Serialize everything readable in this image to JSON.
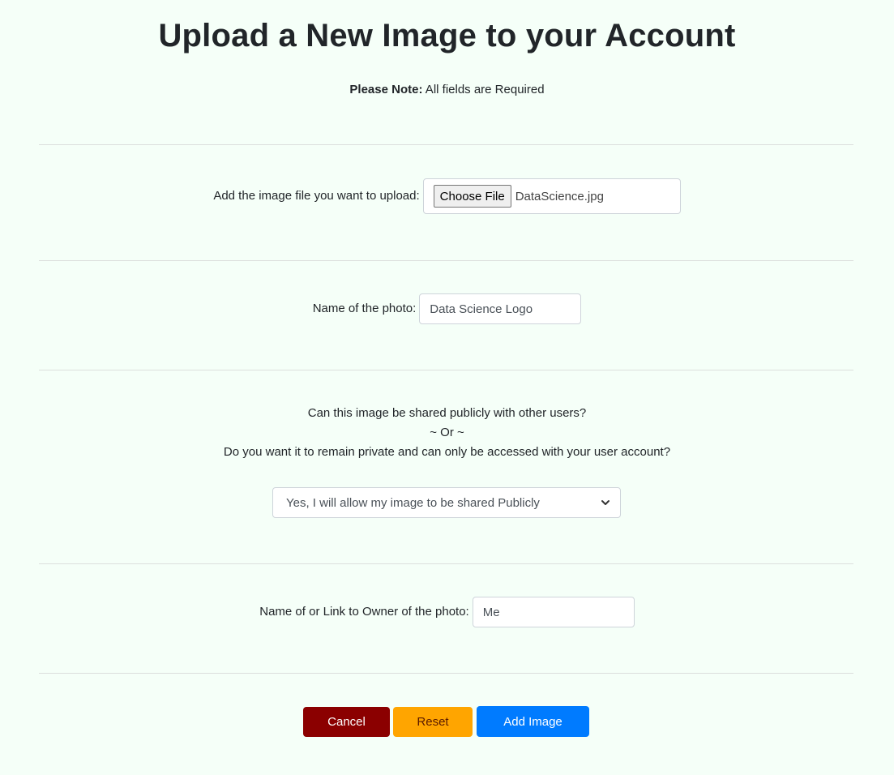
{
  "header": {
    "title": "Upload a New Image to your Account",
    "note_bold": "Please Note:",
    "note_text": " All fields are Required"
  },
  "file_field": {
    "label": "Add the image file you want to upload:",
    "button_label": "Choose File",
    "file_name": "DataScience.jpg"
  },
  "photo_name": {
    "label": "Name of the photo:",
    "value": "Data Science Logo"
  },
  "sharing": {
    "question_line1": "Can this image be shared publicly with other users?",
    "question_line2": "~ Or ~",
    "question_line3": "Do you want it to remain private and can only be accessed with your user account?",
    "selected_option": "Yes, I will allow my image to be shared Publicly",
    "chevron_icon": "chevron-down-icon"
  },
  "owner": {
    "label": "Name of or Link to Owner of the photo:",
    "value": "Me"
  },
  "actions": {
    "cancel_label": "Cancel",
    "reset_label": "Reset",
    "add_label": "Add Image"
  },
  "colors": {
    "background": "#f5fff8",
    "cancel": "#8b0000",
    "reset": "#ffa500",
    "add": "#007bff"
  }
}
